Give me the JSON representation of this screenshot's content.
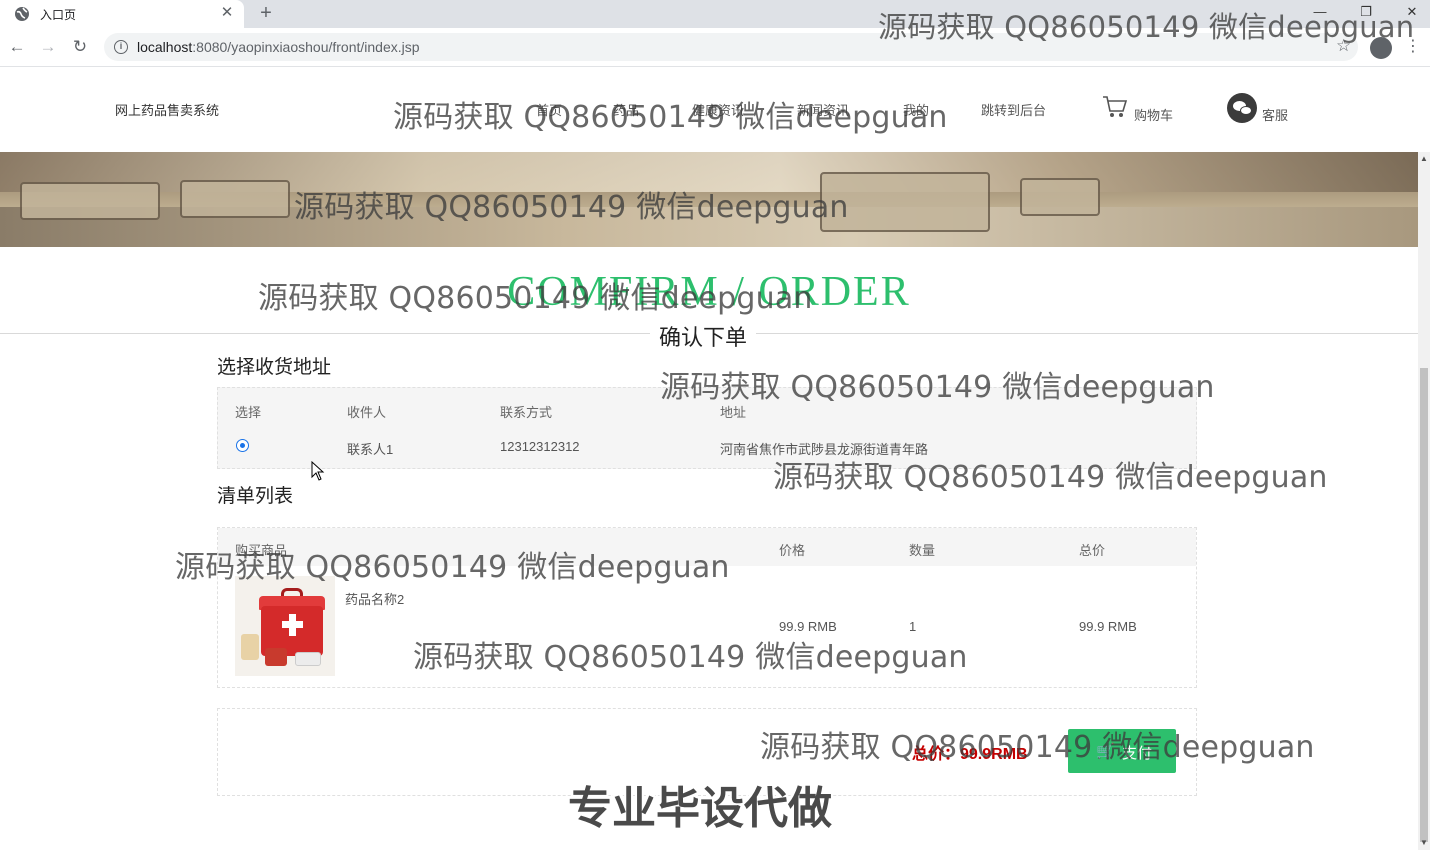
{
  "browser": {
    "tab_title": "入口页",
    "url_host": "localhost",
    "url_path": ":8080/yaopinxiaoshou/front/index.jsp"
  },
  "site": {
    "logo": "网上药品售卖系统",
    "nav": [
      "首页",
      "药品",
      "健康资讯",
      "新闻资讯",
      "我的",
      "跳转到后台"
    ],
    "cart_label": "购物车",
    "service_label": "客服"
  },
  "page": {
    "title_en": "COMFIRM / ORDER",
    "title_cn": "确认下单",
    "accent_color": "#2dbf6d",
    "price_color": "#c40000"
  },
  "address_section": {
    "title": "选择收货地址",
    "columns": [
      "选择",
      "收件人",
      "联系方式",
      "地址"
    ],
    "rows": [
      {
        "selected": true,
        "recipient": "联系人1",
        "phone": "12312312312",
        "address": "河南省焦作市武陟县龙源街道青年路"
      }
    ]
  },
  "items_section": {
    "title": "清单列表",
    "columns": [
      "购买商品",
      "价格",
      "数量",
      "总价"
    ],
    "rows": [
      {
        "name": "药品名称2",
        "price": "99.9 RMB",
        "quantity": "1",
        "total": "99.9 RMB"
      }
    ]
  },
  "summary": {
    "total_text": "总价：99.9RMB",
    "pay_label": "支付"
  },
  "watermarks": {
    "text": "源码获取 QQ86050149 微信deepguan",
    "big": "专业毕设代做"
  }
}
